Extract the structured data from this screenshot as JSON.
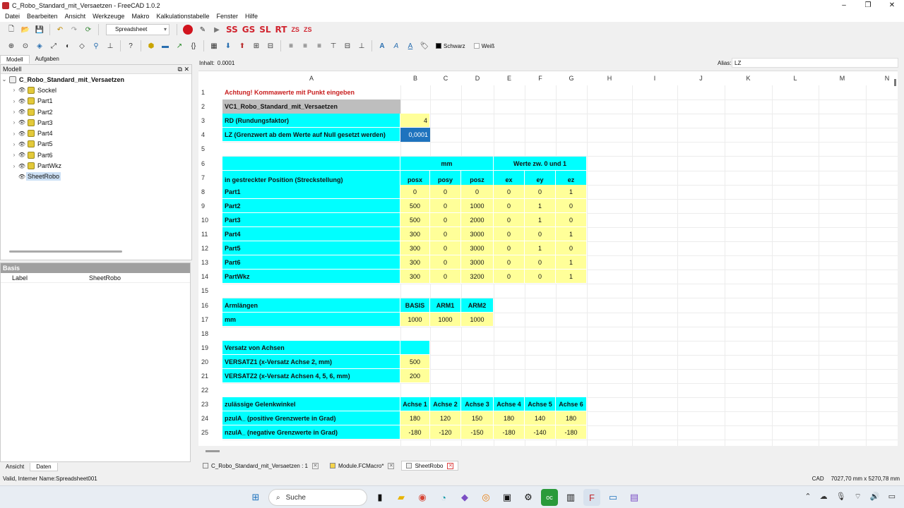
{
  "window": {
    "title": "C_Robo_Standard_mit_Versaetzen - FreeCAD 1.0.2"
  },
  "menu": [
    "Datei",
    "Bearbeiten",
    "Ansicht",
    "Werkzeuge",
    "Makro",
    "Kalkulationstabelle",
    "Fenster",
    "Hilfe"
  ],
  "toolbar": {
    "workbench": "Spreadsheet",
    "macros": [
      "SS",
      "GS",
      "SL",
      "RT"
    ],
    "macros_small": [
      "ZS",
      "ZS"
    ],
    "color_black": "Schwarz",
    "color_white": "Weiß"
  },
  "combo_tabs": [
    "Modell",
    "Aufgaben"
  ],
  "model_panel": {
    "title": "Modell",
    "root": "C_Robo_Standard_mit_Versaetzen",
    "items": [
      "Sockel",
      "Part1",
      "Part2",
      "Part3",
      "Part4",
      "Part5",
      "Part6",
      "PartWkz",
      "SheetRobo"
    ]
  },
  "props": {
    "group": "Basis",
    "label_key": "Label",
    "label_value": "SheetRobo"
  },
  "bottom_tabs": [
    "Ansicht",
    "Daten"
  ],
  "formula": {
    "content_label": "Inhalt:",
    "content_value": "0.0001",
    "alias_label": "Alias:",
    "alias_value": "LZ"
  },
  "columns": [
    "A",
    "B",
    "C",
    "D",
    "E",
    "F",
    "G",
    "H",
    "I",
    "J",
    "K",
    "L",
    "M",
    "N"
  ],
  "rows": [
    "1",
    "2",
    "3",
    "4",
    "5",
    "6",
    "7",
    "8",
    "9",
    "10",
    "11",
    "12",
    "13",
    "14",
    "15",
    "16",
    "17",
    "18",
    "19",
    "20",
    "21",
    "22",
    "23",
    "24",
    "25"
  ],
  "cells": {
    "A1": "Achtung! Kommawerte mit Punkt eingeben",
    "A2": "VC1_Robo_Standard_mit_Versaetzen",
    "A3": "RD (Rundungsfaktor)",
    "B3": "4",
    "A4": "LZ (Grenzwert ab dem Werte auf Null gesetzt werden)",
    "B4": "0,0001",
    "C6": "mm",
    "E6": "Werte zw. 0 und 1",
    "A7": "in gestreckter Position (Streckstellung)",
    "B7": "posx",
    "C7": "posy",
    "D7": "posz",
    "E7": "ex",
    "F7": "ey",
    "G7": "ez",
    "parts": [
      {
        "name": "Part1",
        "v": [
          "0",
          "0",
          "0",
          "0",
          "0",
          "1"
        ]
      },
      {
        "name": "Part2",
        "v": [
          "500",
          "0",
          "1000",
          "0",
          "1",
          "0"
        ]
      },
      {
        "name": "Part3",
        "v": [
          "500",
          "0",
          "2000",
          "0",
          "1",
          "0"
        ]
      },
      {
        "name": "Part4",
        "v": [
          "300",
          "0",
          "3000",
          "0",
          "0",
          "1"
        ]
      },
      {
        "name": "Part5",
        "v": [
          "300",
          "0",
          "3000",
          "0",
          "1",
          "0"
        ]
      },
      {
        "name": "Part6",
        "v": [
          "300",
          "0",
          "3000",
          "0",
          "0",
          "1"
        ]
      },
      {
        "name": "PartWkz",
        "v": [
          "300",
          "0",
          "3200",
          "0",
          "0",
          "1"
        ]
      }
    ],
    "A16": "Armlängen",
    "B16": "BASIS",
    "C16": "ARM1",
    "D16": "ARM2",
    "A17": "mm",
    "B17": "1000",
    "C17": "1000",
    "D17": "1000",
    "A19": "Versatz von Achsen",
    "A20": "VERSATZ1 (x-Versatz Achse 2, mm)",
    "B20": "500",
    "A21": "VERSATZ2 (x-Versatz Achsen 4, 5, 6, mm)",
    "B21": "200",
    "A23": "zulässige Gelenkwinkel",
    "axes": [
      "Achse 1",
      "Achse 2",
      "Achse 3",
      "Achse 4",
      "Achse 5",
      "Achse 6"
    ],
    "A24": "pzulA_ (positive Grenzwerte in Grad)",
    "row24": [
      "180",
      "120",
      "150",
      "180",
      "140",
      "180"
    ],
    "A25": "nzulA_ (negative Grenzwerte in Grad)",
    "row25": [
      "-180",
      "-120",
      "-150",
      "-180",
      "-140",
      "-180"
    ]
  },
  "doc_tabs": [
    {
      "label": "C_Robo_Standard_mit_Versaetzen : 1"
    },
    {
      "label": "Module.FCMacro*"
    },
    {
      "label": "SheetRobo"
    }
  ],
  "status": {
    "message": "Valid, Interner Name:Spreadsheet001",
    "nav": "CAD",
    "dims": "7027,70 mm x 5270,78 mm"
  },
  "taskbar": {
    "search": "Suche"
  }
}
